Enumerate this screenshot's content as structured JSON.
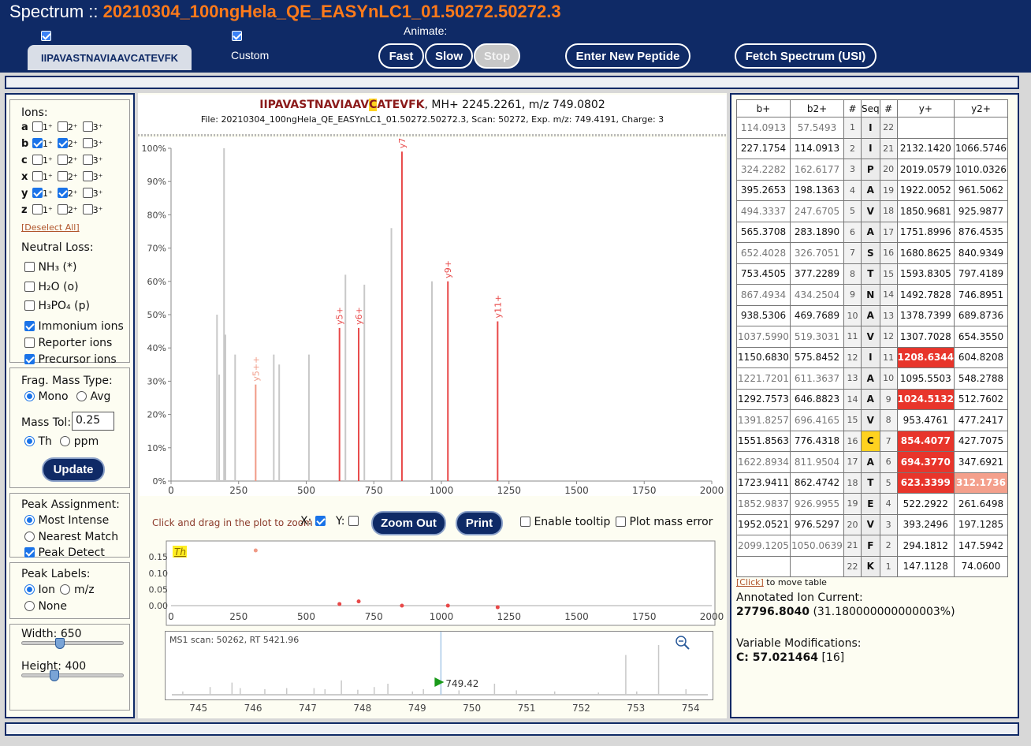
{
  "header": {
    "app_name": "Spectrum ::",
    "file_title": "20210304_100ngHela_QE_EASYnLC1_01.50272.50272.3",
    "peptide_tab": "IIPAVASTNAVIAAVCATEVFK",
    "custom_label": "Custom",
    "animate_label": "Animate:",
    "buttons": {
      "fast": "Fast",
      "slow": "Slow",
      "stop": "Stop",
      "new_peptide": "Enter New Peptide",
      "fetch": "Fetch Spectrum (USI)"
    }
  },
  "left": {
    "ions_label": "Ions:",
    "ion_rows": [
      {
        "ion": "a",
        "c1": false,
        "c2": false,
        "c3": false
      },
      {
        "ion": "b",
        "c1": true,
        "c2": true,
        "c3": false
      },
      {
        "ion": "c",
        "c1": false,
        "c2": false,
        "c3": false
      },
      {
        "ion": "x",
        "c1": false,
        "c2": false,
        "c3": false
      },
      {
        "ion": "y",
        "c1": true,
        "c2": true,
        "c3": false
      },
      {
        "ion": "z",
        "c1": false,
        "c2": false,
        "c3": false
      }
    ],
    "charge1": "1⁺",
    "charge2": "2⁺",
    "charge3": "3⁺",
    "deselect_all": "[Deselect All]",
    "neutral_loss_label": "Neutral Loss:",
    "nl_nh3": "NH₃ (*)",
    "nl_h2o": "H₂O (o)",
    "nl_h3po4": "H₃PO₄ (p)",
    "immonium": "Immonium ions",
    "reporter": "Reporter ions",
    "precursor": "Precursor ions",
    "frag_mass_type": "Frag. Mass Type:",
    "mono": "Mono",
    "avg": "Avg",
    "mass_tol_label": "Mass Tol:",
    "mass_tol_value": "0.25",
    "th": "Th",
    "ppm": "ppm",
    "update": "Update",
    "peak_assignment": "Peak Assignment:",
    "most_intense": "Most Intense",
    "nearest_match": "Nearest Match",
    "peak_detect": "Peak Detect",
    "peak_labels": "Peak Labels:",
    "ion": "Ion",
    "mz": "m/z",
    "none": "None",
    "width_label": "Width: 650",
    "height_label": "Height: 400",
    "width_value": 650,
    "height_value": 400
  },
  "center": {
    "peptide_before": "IIPAVASTNAVIAAV",
    "peptide_mod": "C",
    "peptide_after": "ATEVFK",
    "mh_text": ", MH+ 2245.2261, m/z 749.0802",
    "file_line": "File: 20210304_100ngHela_QE_EASYnLC1_01.50272.50272.3, Scan: 50272, Exp. m/z: 749.4191, Charge: 3",
    "zoom_hint": "Click and drag in the plot to zoom",
    "x_label": "X:",
    "y_label": "Y:",
    "zoom_out": "Zoom Out",
    "print": "Print",
    "enable_tooltip": "Enable tooltip",
    "plot_mass_error": "Plot mass error",
    "error_unit": "Th",
    "ms1_label": "MS1 scan: 50262, RT 5421.96",
    "precursor_label": "749.42"
  },
  "chart_data": [
    {
      "type": "bar",
      "name": "ms2",
      "xlim": [
        0,
        2000
      ],
      "ylim": [
        0,
        100
      ],
      "xticks": [
        0,
        250,
        500,
        750,
        1000,
        1250,
        1500,
        1750,
        2000
      ],
      "yticks": [
        "0%",
        "10%",
        "20%",
        "30%",
        "40%",
        "50%",
        "60%",
        "70%",
        "80%",
        "90%",
        "100%"
      ],
      "peaks": [
        {
          "x": 170,
          "y": 50,
          "c": "gray"
        },
        {
          "x": 178,
          "y": 32,
          "c": "gray"
        },
        {
          "x": 196,
          "y": 100,
          "c": "gray"
        },
        {
          "x": 201,
          "y": 44,
          "c": "gray"
        },
        {
          "x": 237,
          "y": 38,
          "c": "gray"
        },
        {
          "x": 313,
          "y": 29,
          "c": "salmon",
          "label": "y5++"
        },
        {
          "x": 380,
          "y": 38,
          "c": "gray"
        },
        {
          "x": 400,
          "y": 35,
          "c": "gray"
        },
        {
          "x": 510,
          "y": 38,
          "c": "gray"
        },
        {
          "x": 623,
          "y": 46,
          "c": "red",
          "label": "y5+"
        },
        {
          "x": 645,
          "y": 62,
          "c": "gray"
        },
        {
          "x": 694,
          "y": 46,
          "c": "red",
          "label": "y6+"
        },
        {
          "x": 715,
          "y": 59,
          "c": "gray"
        },
        {
          "x": 815,
          "y": 76,
          "c": "gray"
        },
        {
          "x": 854,
          "y": 99,
          "c": "red",
          "label": "y7+"
        },
        {
          "x": 965,
          "y": 60,
          "c": "gray"
        },
        {
          "x": 1024,
          "y": 60,
          "c": "red",
          "label": "y9+"
        },
        {
          "x": 1208,
          "y": 48,
          "c": "red",
          "label": "y11+"
        }
      ]
    },
    {
      "type": "scatter",
      "name": "mass-error",
      "xlim": [
        0,
        2000
      ],
      "ylim": [
        0,
        0.17
      ],
      "yticks": [
        "0.00",
        "0.05",
        "0.10",
        "0.15"
      ],
      "points": [
        {
          "x": 313,
          "y": 0.17,
          "c": "salmon"
        },
        {
          "x": 623,
          "y": 0.005,
          "c": "red"
        },
        {
          "x": 694,
          "y": 0.013,
          "c": "red"
        },
        {
          "x": 854,
          "y": 0.0,
          "c": "red"
        },
        {
          "x": 1024,
          "y": 0.0,
          "c": "red"
        },
        {
          "x": 1208,
          "y": -0.005,
          "c": "red"
        }
      ]
    },
    {
      "type": "bar",
      "name": "ms1",
      "xlim": [
        744.5,
        754.3
      ],
      "ylim": [
        0,
        100
      ],
      "xticks": [
        745,
        746,
        747,
        748,
        749,
        750,
        751,
        752,
        753,
        754
      ],
      "peaks": [
        {
          "x": 744.7,
          "y": 6
        },
        {
          "x": 745.2,
          "y": 14
        },
        {
          "x": 745.6,
          "y": 22
        },
        {
          "x": 745.75,
          "y": 12
        },
        {
          "x": 746.2,
          "y": 10
        },
        {
          "x": 746.6,
          "y": 12
        },
        {
          "x": 747.1,
          "y": 12
        },
        {
          "x": 747.3,
          "y": 10
        },
        {
          "x": 747.6,
          "y": 26
        },
        {
          "x": 747.9,
          "y": 9
        },
        {
          "x": 748.2,
          "y": 14
        },
        {
          "x": 748.45,
          "y": 20
        },
        {
          "x": 748.9,
          "y": 6
        },
        {
          "x": 749.1,
          "y": 10
        },
        {
          "x": 749.42,
          "y": 12
        },
        {
          "x": 749.75,
          "y": 8
        },
        {
          "x": 750.4,
          "y": 20
        },
        {
          "x": 750.8,
          "y": 8
        },
        {
          "x": 751.5,
          "y": 6
        },
        {
          "x": 752.3,
          "y": 4
        },
        {
          "x": 752.8,
          "y": 72
        },
        {
          "x": 753.0,
          "y": 6
        },
        {
          "x": 753.4,
          "y": 90
        },
        {
          "x": 753.9,
          "y": 10
        }
      ],
      "precursor": 749.42
    }
  ],
  "table": {
    "headers": [
      "b+",
      "b2+",
      "#",
      "Seq",
      "#",
      "y+",
      "y2+"
    ],
    "rows": [
      [
        "114.0913",
        "57.5493",
        "1",
        "I",
        "22",
        "",
        ""
      ],
      [
        "227.1754",
        "114.0913",
        "2",
        "I",
        "21",
        "2132.1420",
        "1066.5746"
      ],
      [
        "324.2282",
        "162.6177",
        "3",
        "P",
        "20",
        "2019.0579",
        "1010.0326"
      ],
      [
        "395.2653",
        "198.1363",
        "4",
        "A",
        "19",
        "1922.0052",
        "961.5062"
      ],
      [
        "494.3337",
        "247.6705",
        "5",
        "V",
        "18",
        "1850.9681",
        "925.9877"
      ],
      [
        "565.3708",
        "283.1890",
        "6",
        "A",
        "17",
        "1751.8996",
        "876.4535"
      ],
      [
        "652.4028",
        "326.7051",
        "7",
        "S",
        "16",
        "1680.8625",
        "840.9349"
      ],
      [
        "753.4505",
        "377.2289",
        "8",
        "T",
        "15",
        "1593.8305",
        "797.4189"
      ],
      [
        "867.4934",
        "434.2504",
        "9",
        "N",
        "14",
        "1492.7828",
        "746.8951"
      ],
      [
        "938.5306",
        "469.7689",
        "10",
        "A",
        "13",
        "1378.7399",
        "689.8736"
      ],
      [
        "1037.5990",
        "519.3031",
        "11",
        "V",
        "12",
        "1307.7028",
        "654.3550"
      ],
      [
        "1150.6830",
        "575.8452",
        "12",
        "I",
        "11",
        "1208.6344",
        "604.8208"
      ],
      [
        "1221.7201",
        "611.3637",
        "13",
        "A",
        "10",
        "1095.5503",
        "548.2788"
      ],
      [
        "1292.7573",
        "646.8823",
        "14",
        "A",
        "9",
        "1024.5132",
        "512.7602"
      ],
      [
        "1391.8257",
        "696.4165",
        "15",
        "V",
        "8",
        "953.4761",
        "477.2417"
      ],
      [
        "1551.8563",
        "776.4318",
        "16",
        "C",
        "7",
        "854.4077",
        "427.7075"
      ],
      [
        "1622.8934",
        "811.9504",
        "17",
        "A",
        "6",
        "694.3770",
        "347.6921"
      ],
      [
        "1723.9411",
        "862.4742",
        "18",
        "T",
        "5",
        "623.3399",
        "312.1736"
      ],
      [
        "1852.9837",
        "926.9955",
        "19",
        "E",
        "4",
        "522.2922",
        "261.6498"
      ],
      [
        "1952.0521",
        "976.5297",
        "20",
        "V",
        "3",
        "393.2496",
        "197.1285"
      ],
      [
        "2099.1205",
        "1050.0639",
        "21",
        "F",
        "2",
        "294.1812",
        "147.5942"
      ],
      [
        "",
        "",
        "22",
        "K",
        "1",
        "147.1128",
        "74.0600"
      ]
    ],
    "hits_y": [
      11,
      13,
      15,
      16,
      17
    ],
    "hits_y2": [
      17
    ],
    "mod_row": 15
  },
  "right": {
    "click_link": "[Click]",
    "move_table": " to move table",
    "aic_label": "Annotated Ion Current:",
    "aic_value": "27796.8040",
    "aic_pct": " (31.180000000000003%)",
    "varmod_label": "Variable Modifications:",
    "varmod_value": "C: 57.021464",
    "varmod_pos": " [16]"
  }
}
